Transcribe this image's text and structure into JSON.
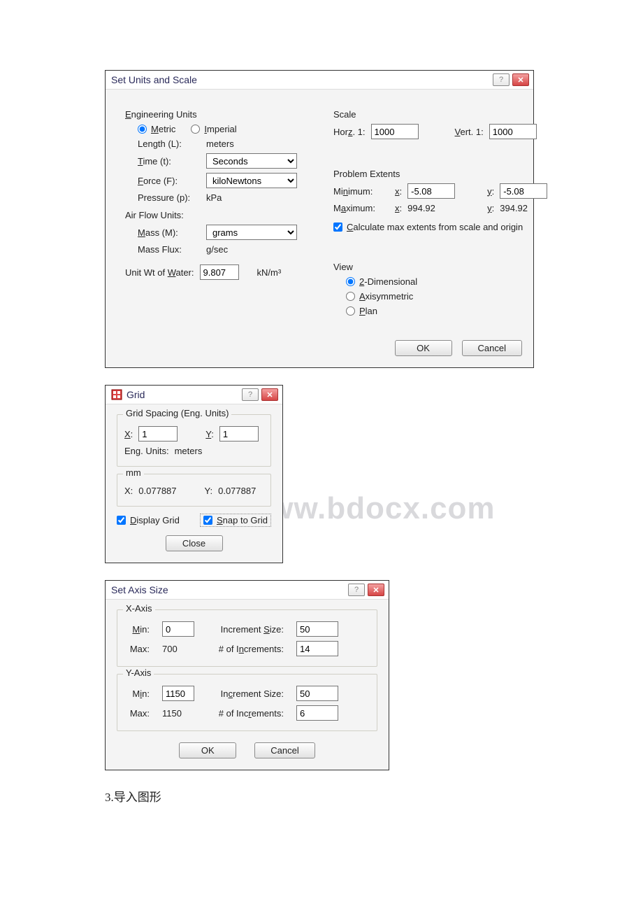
{
  "watermark": "www.bdocx.com",
  "units_dialog": {
    "title": "Set Units and Scale",
    "help_icon": "?",
    "close_icon": "✕",
    "engineering_units_title": "Engineering Units",
    "metric_label": "Metric",
    "imperial_label": "Imperial",
    "length_label": "Length (L):",
    "length_value": "meters",
    "time_label": "Time (t):",
    "time_value": "Seconds",
    "force_label": "Force (F):",
    "force_value": "kiloNewtons",
    "pressure_label": "Pressure (p):",
    "pressure_value": "kPa",
    "airflow_title": "Air Flow Units:",
    "mass_label": "Mass (M):",
    "mass_value": "grams",
    "massflux_label": "Mass Flux:",
    "massflux_value": "g/sec",
    "unitwt_label": "Unit Wt of Water:",
    "unitwt_value": "9.807",
    "unitwt_unit": "kN/m³",
    "scale_title": "Scale",
    "horz_label": "Horz. 1:",
    "horz_value": "1000",
    "vert_label": "Vert. 1:",
    "vert_value": "1000",
    "extents_title": "Problem Extents",
    "min_label": "Minimum:",
    "max_label": "Maximum:",
    "x_label": "x:",
    "y_label": "y:",
    "min_x": "-5.08",
    "min_y": "-5.08",
    "max_x": "994.92",
    "max_y": "394.92",
    "calc_label": "Calculate max extents from scale and origin",
    "view_title": "View",
    "view_2d": "2-Dimensional",
    "view_axis": "Axisymmetric",
    "view_plan": "Plan",
    "ok": "OK",
    "cancel": "Cancel"
  },
  "grid_dialog": {
    "title": "Grid",
    "help_icon": "?",
    "close_icon": "✕",
    "spacing_title": "Grid Spacing (Eng. Units)",
    "x_label": "X:",
    "x_value": "1",
    "y_label": "Y:",
    "y_value": "1",
    "eng_units_label": "Eng. Units:",
    "eng_units_value": "meters",
    "mm_title": "mm",
    "mm_x_label": "X:",
    "mm_x_value": "0.077887",
    "mm_y_label": "Y:",
    "mm_y_value": "0.077887",
    "display_grid": "Display Grid",
    "snap_grid": "Snap to Grid",
    "close": "Close"
  },
  "axis_dialog": {
    "title": "Set Axis Size",
    "help_icon": "?",
    "close_icon": "✕",
    "x_title": "X-Axis",
    "y_title": "Y-Axis",
    "min_label": "Min:",
    "max_label": "Max:",
    "inc_label": "Increment Size:",
    "num_label": "# of Increments:",
    "x_min": "0",
    "x_max": "700",
    "x_inc": "50",
    "x_num": "14",
    "y_min": "1150",
    "y_max": "1150",
    "y_inc": "50",
    "y_num": "6",
    "ok": "OK",
    "cancel": "Cancel"
  },
  "external": {
    "line3": "3.导入图形"
  }
}
